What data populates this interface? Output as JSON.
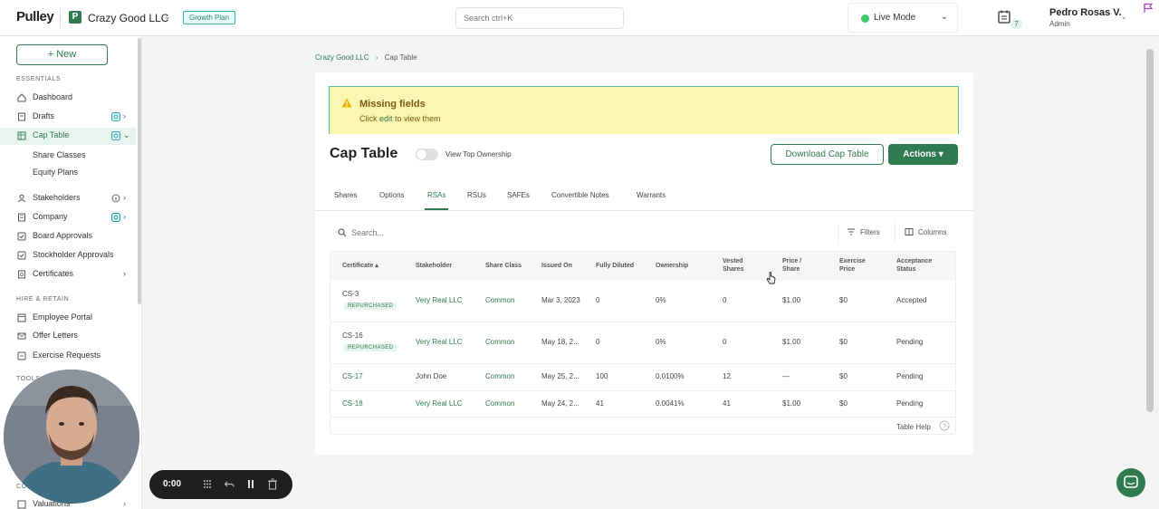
{
  "topbar": {
    "brand": "Pulley",
    "company_initial": "P",
    "company_name": "Crazy Good LLC",
    "plan_badge": "Growth Plan",
    "search_placeholder": "Search ctrl+K",
    "mode_label": "Live Mode",
    "notifications_count": "7",
    "user_name": "Pedro Rosas V.",
    "user_role": "Admin"
  },
  "sidebar": {
    "new_button": "+ New",
    "sections": {
      "essentials": "ESSENTIALS",
      "hire_retain": "HIRE & RETAIN",
      "tools": "TOOLS",
      "co_partial": "CO"
    },
    "items": {
      "dashboard": "Dashboard",
      "drafts": "Drafts",
      "cap_table": "Cap Table",
      "share_classes": "Share Classes",
      "equity_plans": "Equity Plans",
      "stakeholders": "Stakeholders",
      "company": "Company",
      "board_approvals": "Board Approvals",
      "stockholder_approvals": "Stockholder Approvals",
      "certificates": "Certificates",
      "employee_portal": "Employee Portal",
      "offer_letters": "Offer Letters",
      "exercise_requests": "Exercise Requests",
      "valuations": "Valuations"
    }
  },
  "recorder": {
    "time": "0:00"
  },
  "breadcrumb": {
    "parent": "Crazy Good LLC",
    "current": "Cap Table"
  },
  "alert": {
    "title": "Missing fields",
    "text_prefix": "Click ",
    "text_link": "edit",
    "text_suffix": " to view them"
  },
  "header": {
    "title": "Cap Table",
    "toggle_label": "View Top Ownership",
    "download_label": "Download Cap Table",
    "actions_label": "Actions"
  },
  "tabs": {
    "shares": "Shares",
    "options": "Options",
    "rsas": "RSAs",
    "rsus": "RSUs",
    "safes": "SAFEs",
    "convertible_notes": "Convertible Notes",
    "warrants": "Warrants"
  },
  "table": {
    "search_placeholder": "Search...",
    "filters_label": "Filters",
    "columns_label": "Columns",
    "headers": {
      "certificate": "Certificate",
      "stakeholder": "Stakeholder",
      "share_class": "Share Class",
      "issued_on": "Issued On",
      "fully_diluted": "Fully Diluted",
      "ownership": "Ownership",
      "vested_1": "Vested",
      "vested_2": "Shares",
      "price_1": "Price /",
      "price_2": "Share",
      "exercise_1": "Exercise",
      "exercise_2": "Price",
      "acceptance_1": "Acceptance",
      "acceptance_2": "Status"
    },
    "rows": [
      {
        "certificate": "CS-3",
        "badge": "REPURCHASED",
        "stakeholder": "Very Real LLC",
        "share_class": "Common",
        "issued_on": "Mar 3, 2023",
        "fully_diluted": "0",
        "ownership": "0%",
        "vested": "0",
        "price": "$1.00",
        "exercise": "$0",
        "status": "Accepted"
      },
      {
        "certificate": "CS-16",
        "badge": "REPURCHASED",
        "stakeholder": "Very Real LLC",
        "share_class": "Common",
        "issued_on": "May 18, 2...",
        "fully_diluted": "0",
        "ownership": "0%",
        "vested": "0",
        "price": "$1.00",
        "exercise": "$0",
        "status": "Pending"
      },
      {
        "certificate": "CS-17",
        "badge": "",
        "stakeholder": "John Doe",
        "share_class": "Common",
        "issued_on": "May 25, 2...",
        "fully_diluted": "100",
        "ownership": "0.0100%",
        "vested": "12",
        "price": "—",
        "exercise": "$0",
        "status": "Pending"
      },
      {
        "certificate": "CS-18",
        "badge": "",
        "stakeholder": "Very Real LLC",
        "share_class": "Common",
        "issued_on": "May 24, 2...",
        "fully_diluted": "41",
        "ownership": "0.0041%",
        "vested": "41",
        "price": "$1.00",
        "exercise": "$0",
        "status": "Pending"
      }
    ],
    "help_label": "Table Help"
  },
  "colors": {
    "brand_green": "#2f7a4f",
    "alert_bg": "#fbf7b3",
    "live_dot": "#3ec46d"
  },
  "icons": [
    "calendar-icon",
    "flag-icon",
    "home-icon",
    "drafts-icon",
    "table-icon",
    "users-icon",
    "building-icon",
    "approval-icon",
    "certificate-icon",
    "portal-icon",
    "letter-icon",
    "exercise-icon",
    "warning-icon",
    "search-icon",
    "filter-icon",
    "columns-icon",
    "help-icon",
    "chat-icon"
  ]
}
